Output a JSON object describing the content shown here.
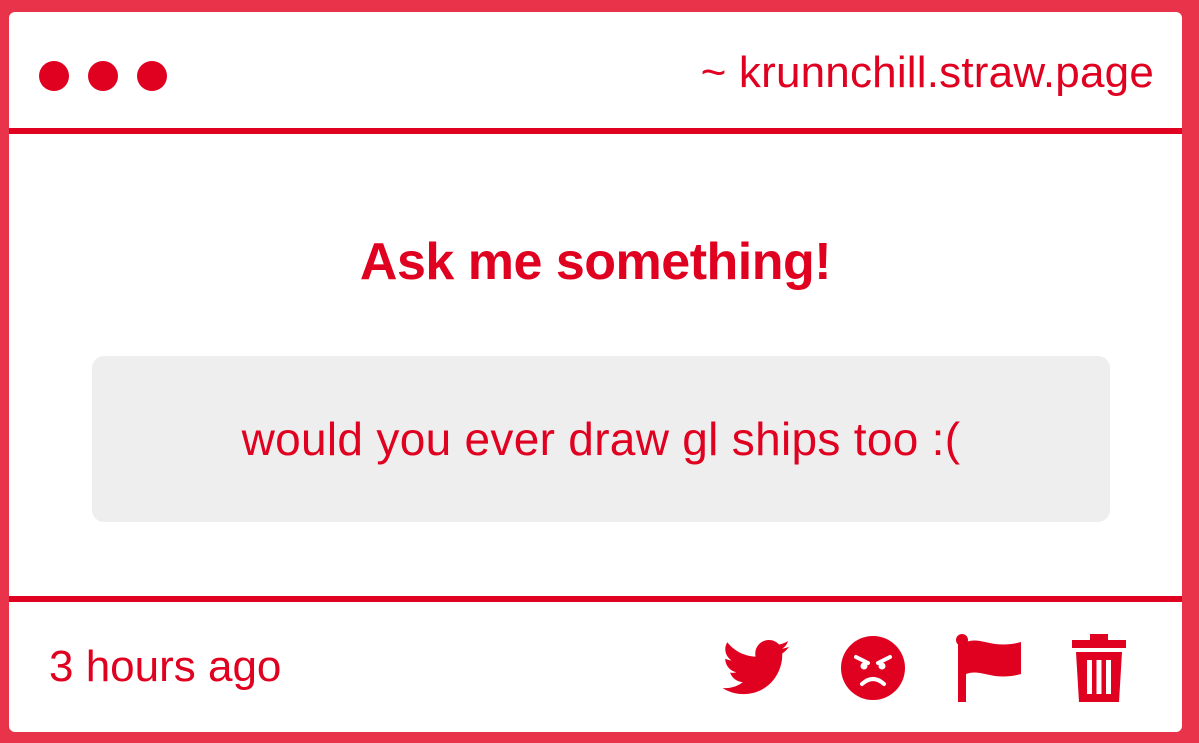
{
  "window": {
    "url": "~ krunnchill.straw.page"
  },
  "main": {
    "heading": "Ask me something!",
    "question": "would you ever draw gl ships too :("
  },
  "footer": {
    "timestamp": "3 hours ago",
    "actions": [
      {
        "icon": "twitter-icon"
      },
      {
        "icon": "angry-face-icon"
      },
      {
        "icon": "flag-icon"
      },
      {
        "icon": "trash-icon"
      }
    ]
  },
  "colors": {
    "accent": "#e00020",
    "border": "#e8334a",
    "question_bg": "#efeeef",
    "card_bg": "#ffffff"
  }
}
